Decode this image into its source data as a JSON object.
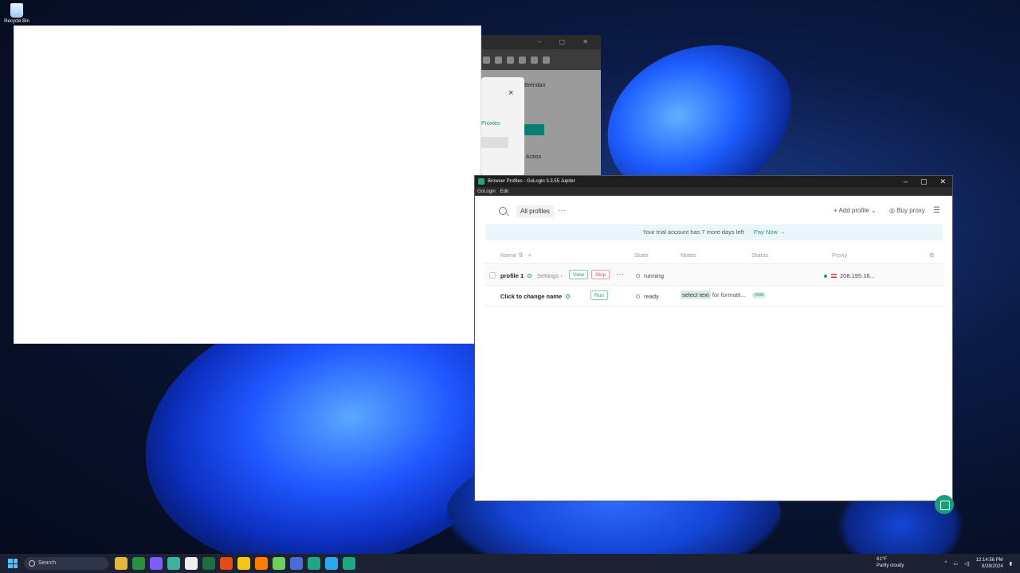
{
  "desktop": {
    "icon_label": "Recycle Bin"
  },
  "background_browser": {
    "user_label": "Brendan",
    "dialog_link": "Proxies",
    "column_label": "Action",
    "close_glyph": "×"
  },
  "gologin": {
    "window_title": "Browser Profiles - GoLogin 3.3.55 Jupiter",
    "menu": [
      "GoLogin",
      "Edit"
    ],
    "toolbar": {
      "tab_all_profiles": "All profiles",
      "more": "···",
      "add_profile": "+ Add profile ⌄",
      "buy_proxy": "Buy proxy"
    },
    "banner": {
      "text": "Your trial account has 7 more days left",
      "pay_now": "Pay Now →"
    },
    "columns": [
      "Name",
      "State",
      "Notes",
      "Status",
      "Proxy"
    ],
    "rows": [
      {
        "name": "profile 1",
        "settings": "Settings",
        "view": "View",
        "stop": "Stop",
        "state": "running",
        "proxy": "208.195.16..."
      },
      {
        "name": "Click to change name",
        "run": "Run",
        "state": "ready",
        "note_highlight": "select text",
        "note_rest": "for formatti...",
        "status_badge": "new"
      }
    ]
  },
  "taskbar": {
    "search": "Search",
    "weather_temp": "61°F",
    "weather_desc": "Partly cloudy",
    "time": "12:14:56 PM",
    "date": "8/28/2024"
  },
  "colors": {
    "accent": "#1a9d7c",
    "stop": "#e05050",
    "taskbar": "#1c2233"
  }
}
